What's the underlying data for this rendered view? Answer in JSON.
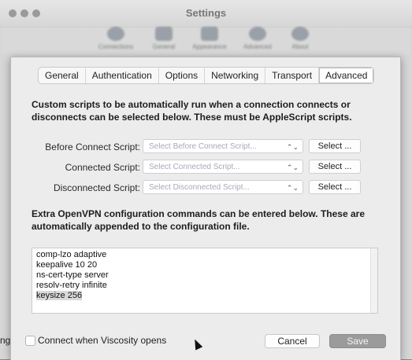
{
  "window": {
    "title": "Settings"
  },
  "toolbar": {
    "items": [
      {
        "label": "Connections",
        "icon": "globe-icon"
      },
      {
        "label": "General",
        "icon": "switch-icon"
      },
      {
        "label": "Appearance",
        "icon": "monitor-icon"
      },
      {
        "label": "Advanced",
        "icon": "gear-icon"
      },
      {
        "label": "About",
        "icon": "info-icon"
      }
    ]
  },
  "background_fragment": "ng'",
  "tabs": [
    "General",
    "Authentication",
    "Options",
    "Networking",
    "Transport",
    "Advanced"
  ],
  "active_tab": "Advanced",
  "scripts_description": "Custom scripts to be automatically run when a connection connects or disconnects can be selected below. These must be AppleScript scripts.",
  "scripts": [
    {
      "label": "Before Connect Script:",
      "placeholder": "Select Before Connect Script...",
      "button": "Select ..."
    },
    {
      "label": "Connected Script:",
      "placeholder": "Select Connected Script...",
      "button": "Select ..."
    },
    {
      "label": "Disconnected Script:",
      "placeholder": "Select Disconnected Script...",
      "button": "Select ..."
    }
  ],
  "config_description": "Extra OpenVPN configuration commands can be entered below. These are automatically appended to the configuration file.",
  "config_lines": [
    "comp-lzo adaptive",
    "keepalive 10 20",
    "ns-cert-type server",
    "resolv-retry infinite",
    "keysize 256"
  ],
  "footer": {
    "checkbox_label": "Connect when Viscosity opens",
    "checkbox_checked": false,
    "cancel": "Cancel",
    "save": "Save"
  },
  "colors": {
    "save_disabled": "#9b9b9b",
    "sheet_bg": "#ececec"
  }
}
